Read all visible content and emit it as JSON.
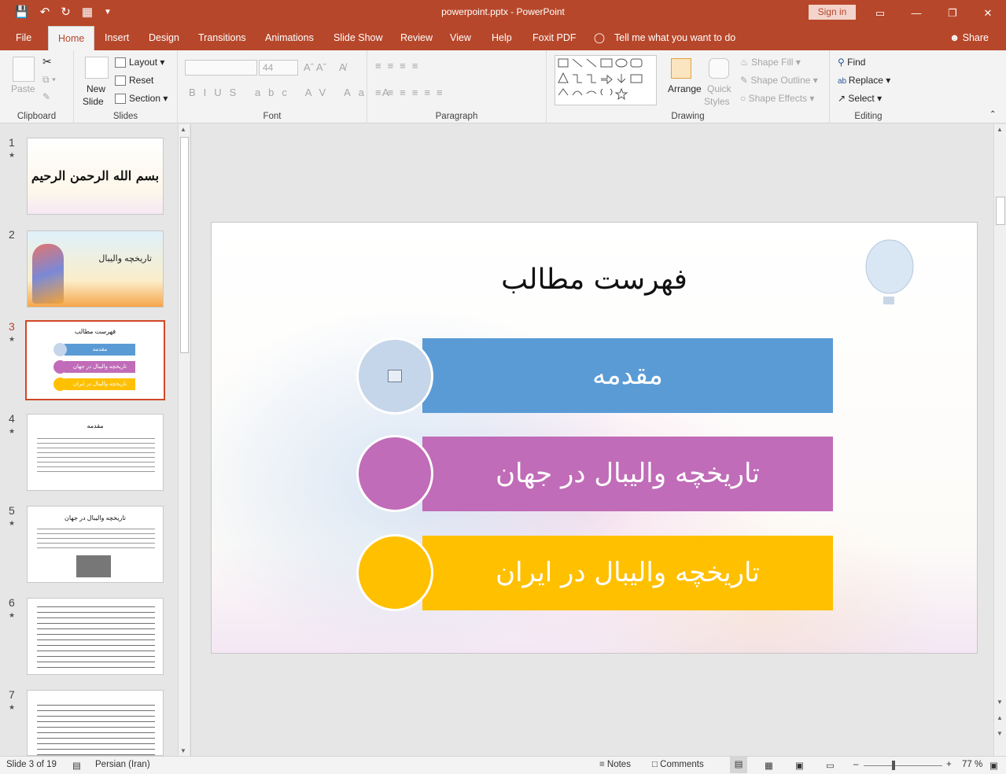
{
  "window": {
    "doc_title": "powerpoint.pptx  -  PowerPoint",
    "signin_label": "Sign in"
  },
  "tabs": [
    "File",
    "Home",
    "Insert",
    "Design",
    "Transitions",
    "Animations",
    "Slide Show",
    "Review",
    "View",
    "Help",
    "Foxit PDF"
  ],
  "tell_me": "Tell me what you want to do",
  "share_label": "Share",
  "ribbon": {
    "clipboard": {
      "paste": "Paste",
      "label": "Clipboard"
    },
    "slides": {
      "new_slide_1": "New",
      "new_slide_2": "Slide",
      "layout": "Layout",
      "reset": "Reset",
      "section": "Section",
      "label": "Slides"
    },
    "font": {
      "size": "44",
      "label": "Font"
    },
    "paragraph": {
      "label": "Paragraph"
    },
    "drawing": {
      "arrange": "Arrange",
      "quick_styles_1": "Quick",
      "quick_styles_2": "Styles",
      "shape_fill": "Shape Fill",
      "shape_outline": "Shape Outline",
      "shape_effects": "Shape Effects",
      "label": "Drawing"
    },
    "editing": {
      "find": "Find",
      "replace": "Replace",
      "select": "Select",
      "label": "Editing"
    }
  },
  "thumbnails": [
    {
      "num": "1",
      "text": "بسم الله الرحمن الرحيم"
    },
    {
      "num": "2",
      "text": "تاریخچه والیبال"
    },
    {
      "num": "3",
      "title": "فهرست مطالب",
      "items": [
        "مقدمه",
        "تاریخچه والیبال در جهان",
        "تاریخچه والیبال در ایران"
      ]
    },
    {
      "num": "4",
      "title": "مقدمه"
    },
    {
      "num": "5",
      "title": "تاریخچه والیبال در جهان"
    },
    {
      "num": "6"
    },
    {
      "num": "7"
    }
  ],
  "slide": {
    "title": "فهرست مطالب",
    "items": [
      {
        "label": "مقدمه",
        "color": "#5b9bd5",
        "circle": "#c5d5ea"
      },
      {
        "label": "تاریخچه والیبال در جهان",
        "color": "#c06cb8",
        "circle": "#c06cb8"
      },
      {
        "label": "تاریخچه والیبال در ایران",
        "color": "#ffc000",
        "circle": "#ffc000"
      }
    ]
  },
  "status": {
    "slide_info": "Slide 3 of 19",
    "language": "Persian (Iran)",
    "notes": "Notes",
    "comments": "Comments",
    "zoom": "77 %"
  }
}
